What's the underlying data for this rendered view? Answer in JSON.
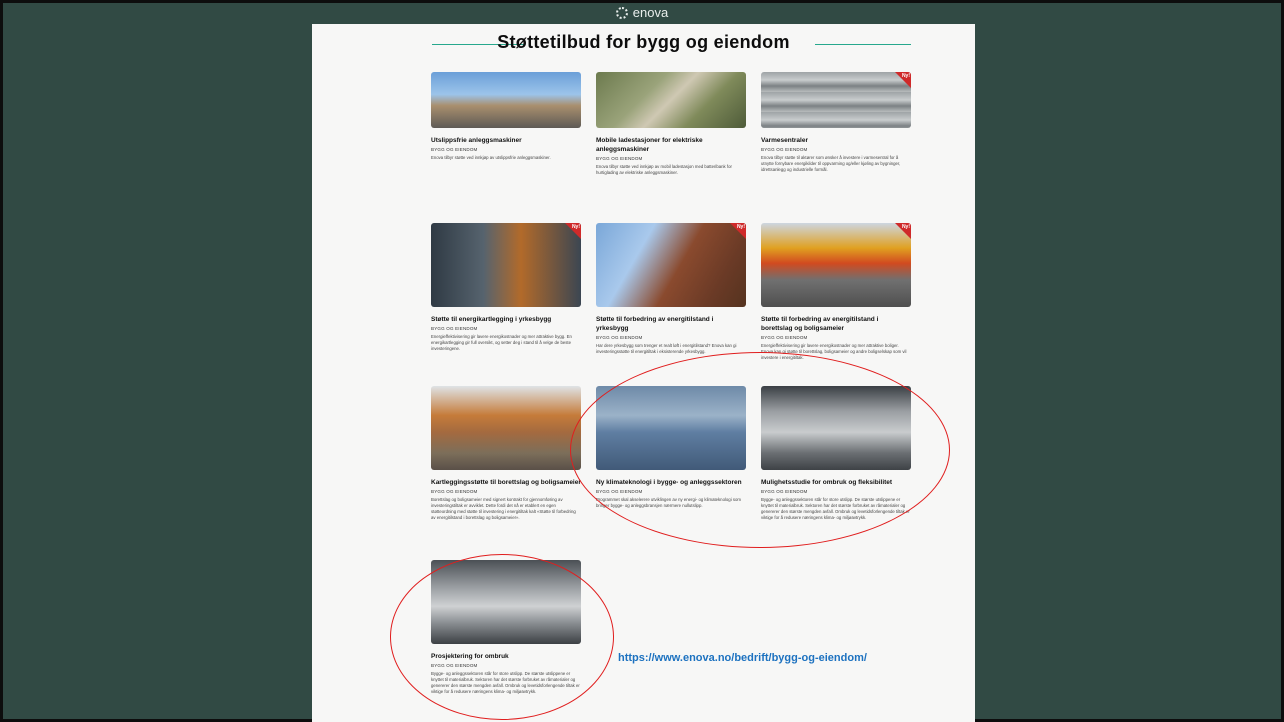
{
  "logo": {
    "text": "enova"
  },
  "page": {
    "title": "Støttetilbud for bygg og eiendom"
  },
  "url": "https://www.enova.no/bedrift/bygg-og-eiendom/",
  "badge": "Ny!",
  "cards": [
    {
      "title": "Utslippsfrie anleggsmaskiner",
      "category": "BYGG OG EIENDOM",
      "description": "Enova tilbyr støtte ved innkjøp av utslippsfrie anleggsmaskiner."
    },
    {
      "title": "Mobile ladestasjoner for elektriske anleggsmaskiner",
      "category": "BYGG OG EIENDOM",
      "description": "Enova tilbyr støtte ved innkjøp av mobil ladestasjon med batteribank for hurtiglading av elektriske anleggsmaskiner."
    },
    {
      "title": "Varmesentraler",
      "category": "BYGG OG EIENDOM",
      "description": "Enova tilbyr støtte til aktører som ønsker å investere i varmesentral for å utnytte fornybare energikilder til oppvarming og/eller kjøling av bygninger, idrettsanlegg og industrielle formål."
    },
    {
      "title": "Støtte til energikartlegging i yrkesbygg",
      "category": "BYGG OG EIENDOM",
      "description": "Energieffektivisering gir lavere energikostnader og mer attraktive bygg. En energikartlegging gir full oversikt, og setter deg i stand til å velge de beste investeringene."
    },
    {
      "title": "Støtte til forbedring av energitilstand i yrkesbygg",
      "category": "BYGG OG EIENDOM",
      "description": "Har dere yrkesbygg som trenger et realt løft i energitilstand? Enova kan gi investeringsstøtte til energitiltak i eksisterende yrkesbygg."
    },
    {
      "title": "Støtte til forbedring av energitilstand i borettslag og boligsameier",
      "category": "BYGG OG EIENDOM",
      "description": "Energieffektivisering gir lavere energikostnader og mer attraktive boliger. Enova kan gi støtte til borettslag, boligsameier og andre boligselskap som vil investere i energitiltak."
    },
    {
      "title": "Kartleggingsstøtte til borettslag og boligsameier",
      "category": "BYGG OG EIENDOM",
      "description": "Borettslag og boligsameier med signert kontrakt for gjennomføring av investeringstiltak er avviklet. Dette fordi det nå er etablert en egen støtteordning med støtte til investering i energitiltak kalt «Støtte til forbedring av energitilstand i borettslag og boligsameier»."
    },
    {
      "title": "Ny klimateknologi i bygge- og anleggssektoren",
      "category": "BYGG OG EIENDOM",
      "description": "Programmet skal akselerere utviklingen av ny energi- og klimateknologi som bringer bygge- og anleggsbransjen nærmere nullutslipp."
    },
    {
      "title": "Mulighetsstudie for ombruk og fleksibilitet",
      "category": "BYGG OG EIENDOM",
      "description": "Bygge- og anleggssektoren står for store utslipp. De største utslippene er knyttet til materialbruk. Sektoren har det største forbruket av råmaterialer og genererer den største mengden avfall. Ombruk og levetidsforlengende tiltak er viktige for å redusere næringens klima- og miljøavtrykk."
    },
    {
      "title": "Prosjektering for ombruk",
      "category": "BYGG OG EIENDOM",
      "description": "Bygge- og anleggssektoren står for store utslipp. De største utslippene er knyttet til materialbruk. Sektoren har det største forbruket av råmaterialer og genererer den største mengden avfall. Ombruk og levetidsforlengende tiltak er viktige for å redusere næringens klima- og miljøavtrykk."
    }
  ]
}
